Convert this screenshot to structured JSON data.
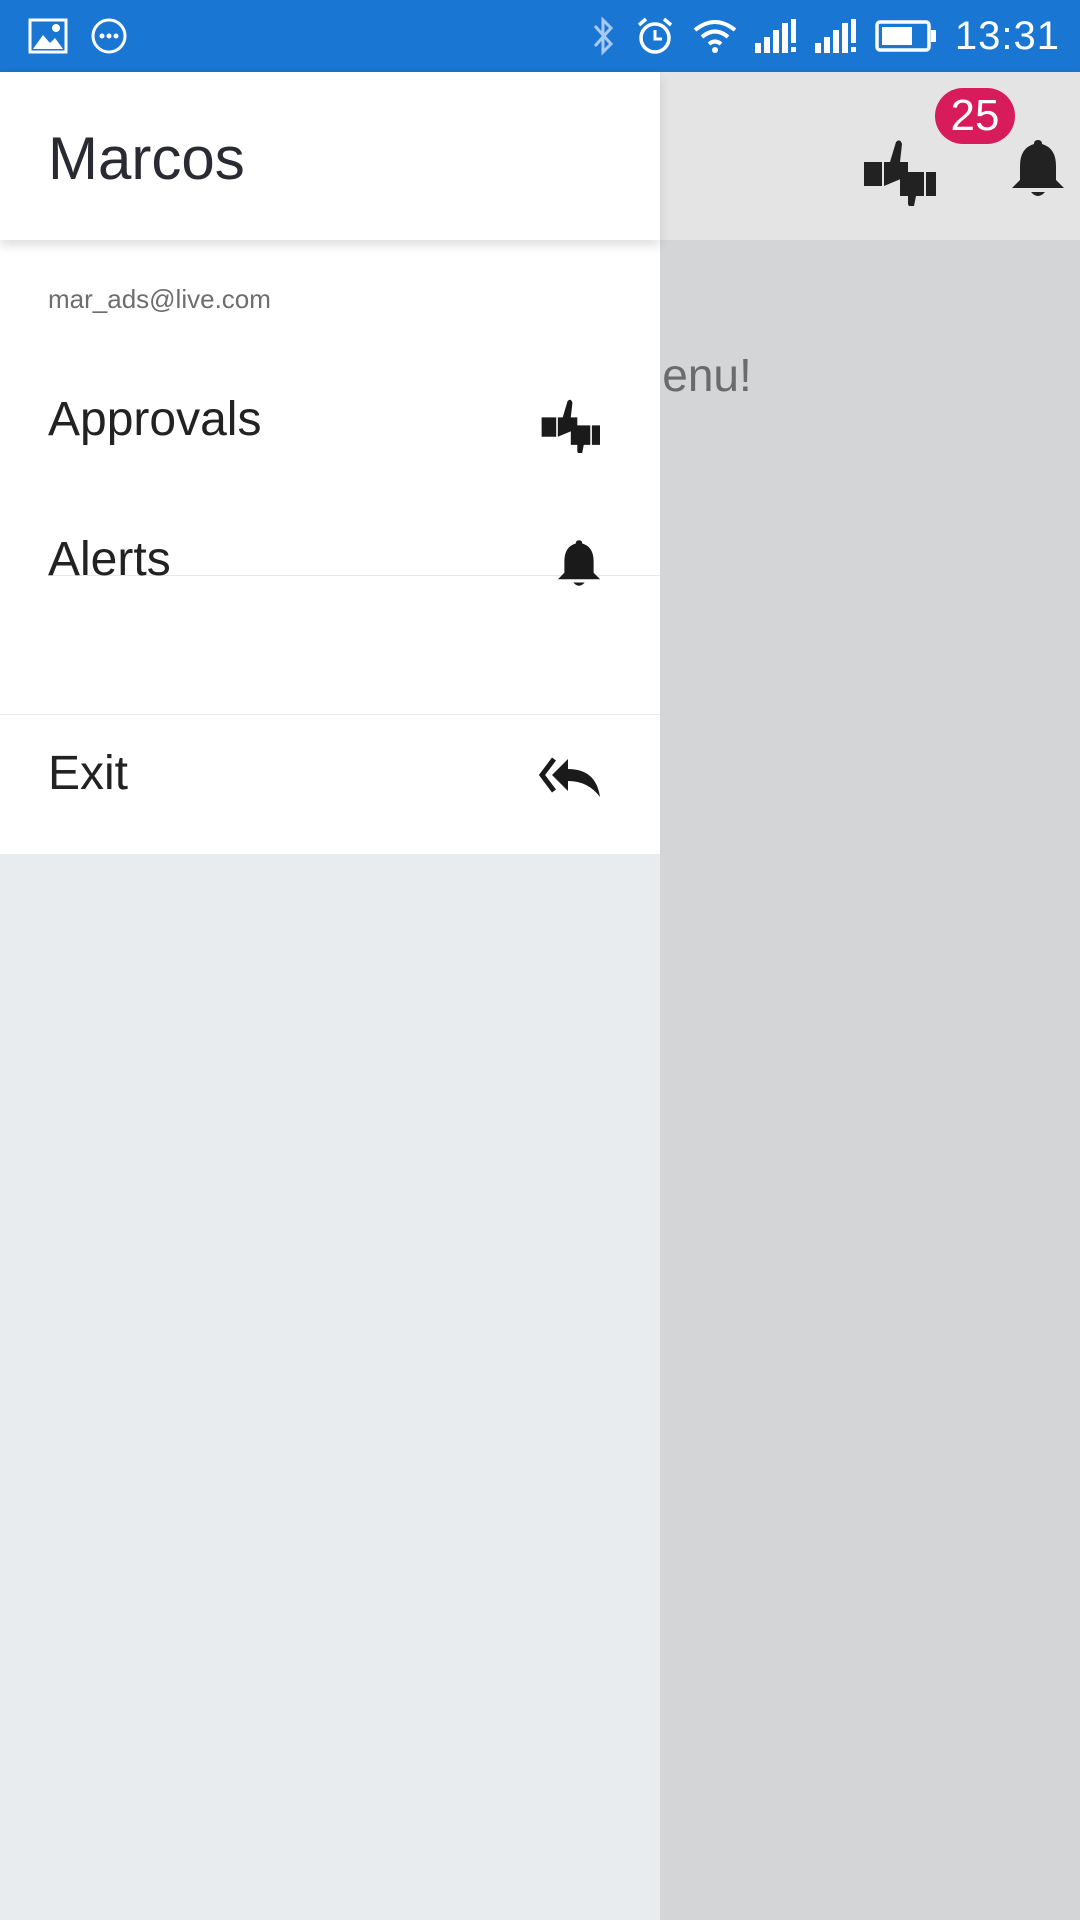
{
  "status_bar": {
    "time": "13:31",
    "left_icons": [
      "image-icon",
      "chat-bubble-icon"
    ],
    "right_icons": [
      "bluetooth-icon",
      "alarm-icon",
      "wifi-icon",
      "signal-1-icon",
      "signal-2-icon",
      "battery-icon"
    ],
    "color": "#1976d2"
  },
  "background_app": {
    "body_text": "he menu!",
    "notification_badge": "25",
    "badge_color": "#d81b5a",
    "header_icons": [
      "approvals-icon",
      "bell-icon"
    ]
  },
  "drawer": {
    "title": "Marcos",
    "email": "mar_ads@live.com",
    "items": [
      {
        "label": "Approvals",
        "icon": "thumbs-up-down-icon"
      },
      {
        "label": "Alerts",
        "icon": "bell-icon"
      },
      {
        "label": "Exit",
        "icon": "reply-all-icon"
      }
    ]
  }
}
